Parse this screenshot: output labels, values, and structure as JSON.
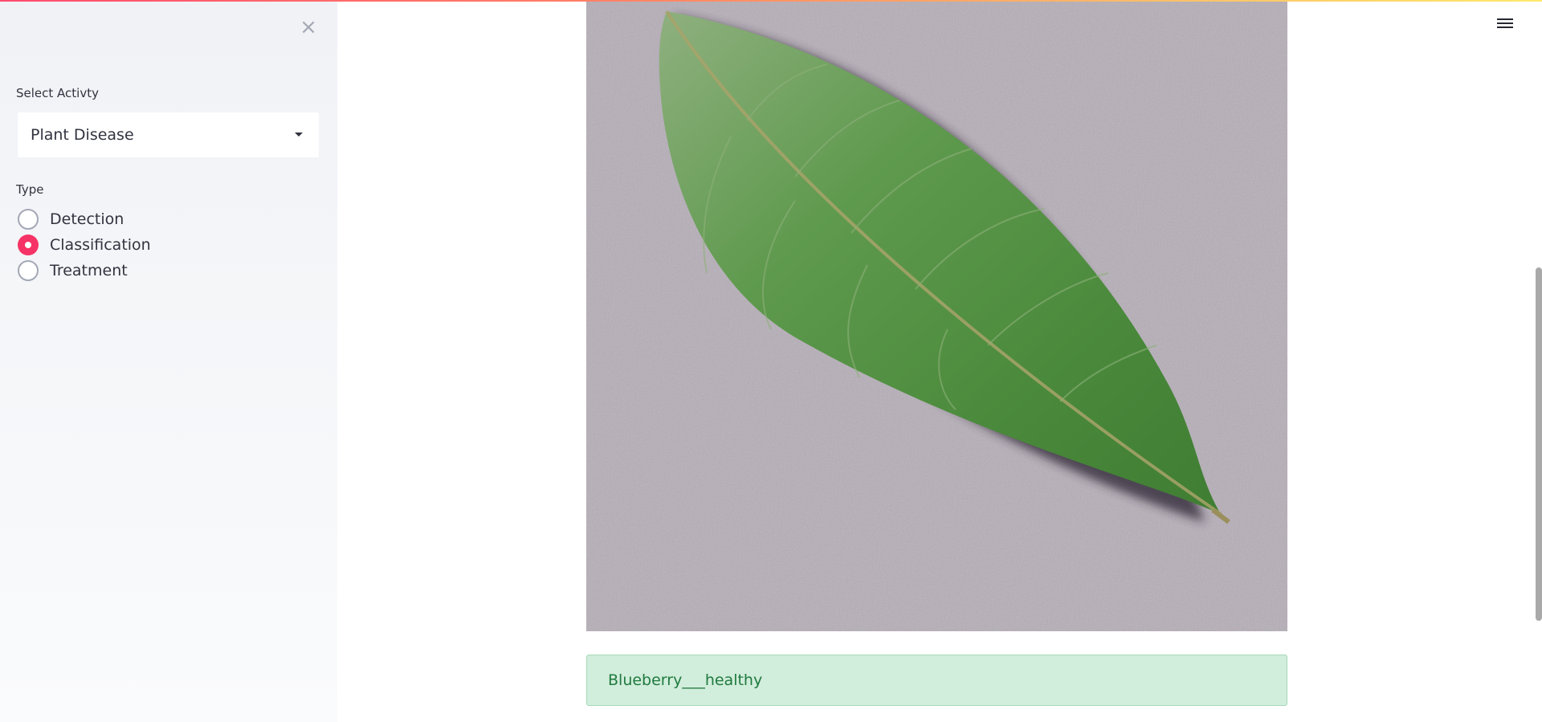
{
  "sidebar": {
    "close_icon": "close-icon",
    "select_label": "Select Activty",
    "select_value": "Plant Disease",
    "type_label": "Type",
    "radio_options": [
      {
        "label": "Detection",
        "checked": false
      },
      {
        "label": "Classification",
        "checked": true
      },
      {
        "label": "Treatment",
        "checked": false
      }
    ]
  },
  "header": {
    "menu_icon": "hamburger-menu-icon"
  },
  "main": {
    "result_text": "Blueberry___healthy"
  },
  "colors": {
    "accent": "#f63366",
    "success_bg": "#d1eddb",
    "success_text": "#1f7a3f",
    "sidebar_bg": "#f0f2f6"
  }
}
